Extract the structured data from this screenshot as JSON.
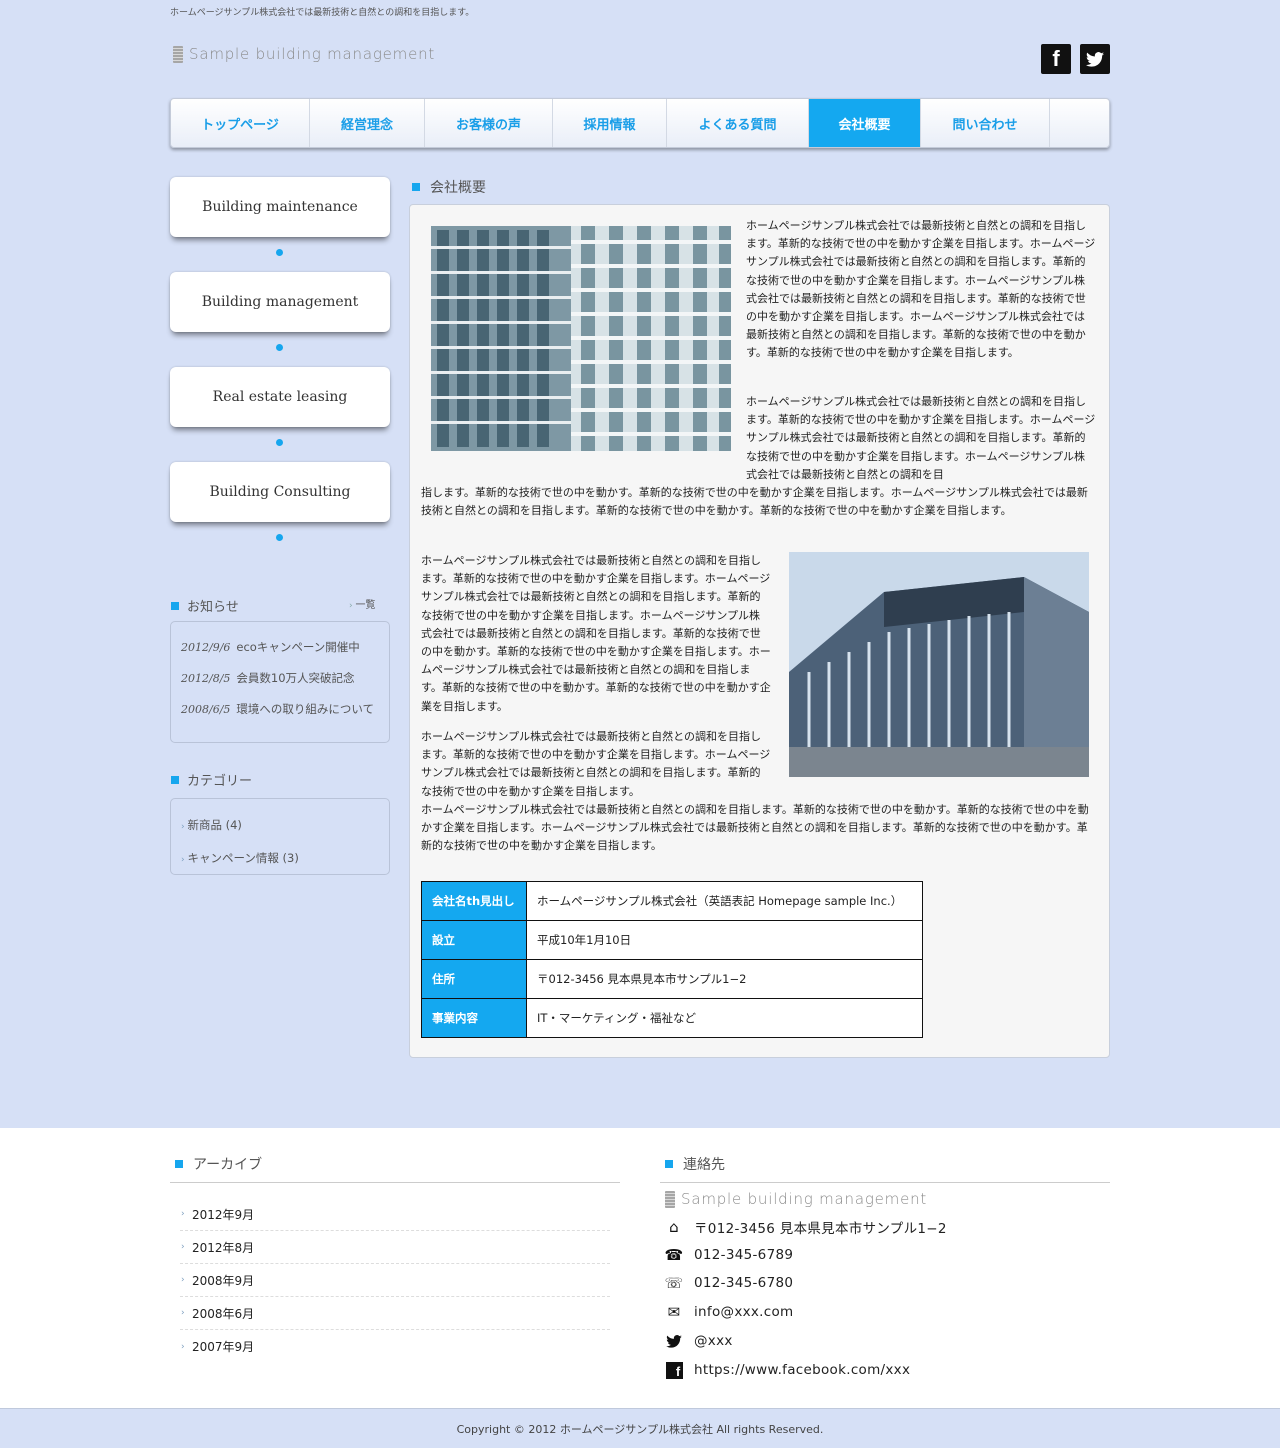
{
  "header": {
    "tagline": "ホームページサンプル株式会社では最新技術と自然との調和を目指します。",
    "logo_text": "Sample building management",
    "facebook_icon_label": "f",
    "twitter_icon_label": "t"
  },
  "nav": {
    "items": [
      {
        "label": "トップページ"
      },
      {
        "label": "経営理念"
      },
      {
        "label": "お客様の声"
      },
      {
        "label": "採用情報"
      },
      {
        "label": "よくある質問"
      },
      {
        "label": "会社概要"
      },
      {
        "label": "問い合わせ"
      },
      {
        "label": ""
      }
    ],
    "active_label": "会社概要"
  },
  "sidebar": {
    "services": [
      {
        "label": "Building maintenance"
      },
      {
        "label": "Building management"
      },
      {
        "label": "Real estate leasing"
      },
      {
        "label": "Building Consulting"
      }
    ],
    "news": {
      "title": "お知らせ",
      "more_label": "一覧",
      "items": [
        {
          "date": "2012/9/6",
          "text": "ecoキャンペーン開催中"
        },
        {
          "date": "2012/8/5",
          "text": "会員数10万人突破記念"
        },
        {
          "date": "2008/6/5",
          "text": "環境への取り組みについて"
        }
      ]
    },
    "categories": {
      "title": "カテゴリー",
      "items": [
        {
          "label": "新商品 (4)"
        },
        {
          "label": "キャンペーン情報 (3)"
        }
      ]
    }
  },
  "main": {
    "title": "会社概要",
    "paragraphs": [
      "ホームページサンプル株式会社では最新技術と自然との調和を目指します。革新的な技術で世の中を動かす企業を目指します。ホームページサンプル株式会社では最新技術と自然との調和を目指します。革新的な技術で世の中を動かす企業を目指します。ホームページサンプル株式会社では最新技術と自然との調和を目指します。革新的な技術で世の中を動かす企業を目指します。ホームページサンプル株式会社では最新技術と自然との調和を目指します。革新的な技術で世の中を動かす。革新的な技術で世の中を動かす企業を目指します。",
      "ホームページサンプル株式会社では最新技術と自然との調和を目指します。革新的な技術で世の中を動かす企業を目指します。ホームページサンプル株式会社では最新技術と自然との調和を目指します。革新的な技術で世の中を動かす企業を目指します。ホームページサンプル株式会社では最新技術と自然との調和を目指します。革新的な技術で世の中を動かす。革新的な技術で世の中を動かす企業を目指します。ホームページサンプル株式会社では最新技術と自然との調和を目指します。革新的な技術で世の中を動かす。革新的な技術で世の中を動かす企業を目指します。",
      "ホームページサンプル株式会社では最新技術と自然との調和を目指します。革新的な技術で世の中を動かす企業を目指します。ホームページサンプル株式会社では最新技術と自然との調和を目指します。革新的な技術で世の中を動かす企業を目指します。ホームページサンプル株式会社では最新技術と自然との調和を目指します。革新的な技術で世の中を動かす企業を目指します。ホームページサンプル株式会社では最新技術と自然との調和を目指します。革新的な技術で世の中を動かす。革新的な技術で世の中を動かす企業を目指します。",
      "ホームページサンプル株式会社では最新技術と自然との調和を目指します。革新的な技術で世の中を動かす企業を目指します。ホームページサンプル株式会社では最新技術と自然との調和を目指します。革新的な技術で世の中を動かす企業を目指します。ホームページサンプル株式会社では最新技術と自然との調和を目指します。革新的な技術で世の中を動かす。革新的な技術で世の中を動かす企業を目指します。ホームページサンプル株式会社では最新技術と自然との調和を目指します。革新的な技術で世の中を動かす。革新的な技術で世の中を動かす企業を目指します。"
    ],
    "table": [
      {
        "th": "会社名th見出し",
        "td": "ホームページサンプル株式会社（英語表記 Homepage sample Inc.）"
      },
      {
        "th": "設立",
        "td": "平成10年1月10日"
      },
      {
        "th": "住所",
        "td": "〒012-3456 見本県見本市サンプル1−2"
      },
      {
        "th": "事業内容",
        "td": "IT・マーケティング・福祉など"
      }
    ]
  },
  "footer": {
    "archive": {
      "title": "アーカイブ",
      "items": [
        {
          "label": "2012年9月"
        },
        {
          "label": "2012年8月"
        },
        {
          "label": "2008年9月"
        },
        {
          "label": "2008年6月"
        },
        {
          "label": "2007年9月"
        }
      ]
    },
    "contact": {
      "title": "連絡先",
      "logo_text": "Sample building management",
      "address": "〒012-3456 見本県見本市サンプル1−2",
      "tel": "012-345-6789",
      "fax": "012-345-6780",
      "email": "info@xxx.com",
      "twitter": "@xxx",
      "facebook": "https://www.facebook.com/xxx"
    },
    "copyright": "Copyright © 2012 ホームページサンプル株式会社 All rights Reserved."
  },
  "colors": {
    "accent": "#14a8f0",
    "page_background": "#d6e0f6"
  }
}
